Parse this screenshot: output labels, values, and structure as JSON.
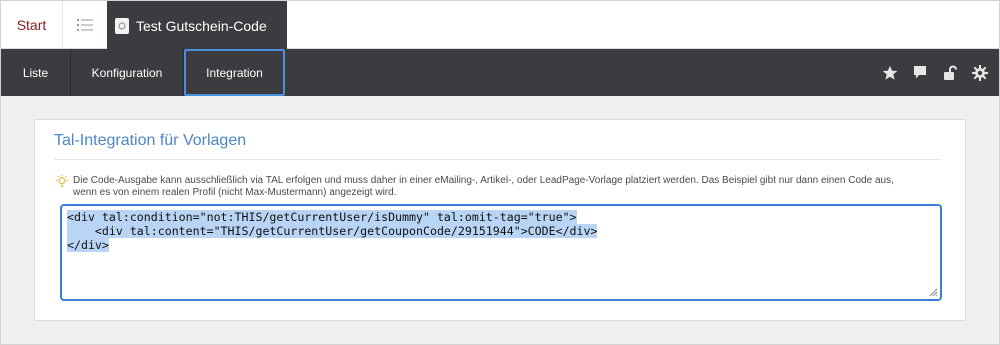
{
  "tabs": {
    "start_label": "Start",
    "active_title": "Test Gutschein-Code"
  },
  "nav": {
    "items": [
      {
        "label": "Liste"
      },
      {
        "label": "Konfiguration"
      },
      {
        "label": "Integration"
      }
    ],
    "active_index": 2,
    "icons": [
      "star-icon",
      "comment-icon",
      "unlock-icon",
      "gear-icon"
    ]
  },
  "panel": {
    "title": "Tal-Integration für Vorlagen",
    "hint_line1": "Die Code-Ausgabe kann ausschließlich via TAL erfolgen und muss daher in einer eMailing-, Artikel-, oder LeadPage-Vorlage platziert werden. Das Beispiel gibt nur dann einen Code aus,",
    "hint_line2": "wenn es von einem realen Profil (nicht Max-Mustermann) angezeigt wird.",
    "code_line1": "<div tal:condition=\"not:THIS/getCurrentUser/isDummy\" tal:omit-tag=\"true\">",
    "code_line2": "    <div tal:content=\"THIS/getCurrentUser/getCouponCode/29151944\">CODE</div>",
    "code_line3": "</div>"
  },
  "colors": {
    "accent": "#4a8fe0",
    "title": "#4a86c8",
    "nav_bg": "#3a3c3f",
    "start": "#8b1a1a"
  }
}
